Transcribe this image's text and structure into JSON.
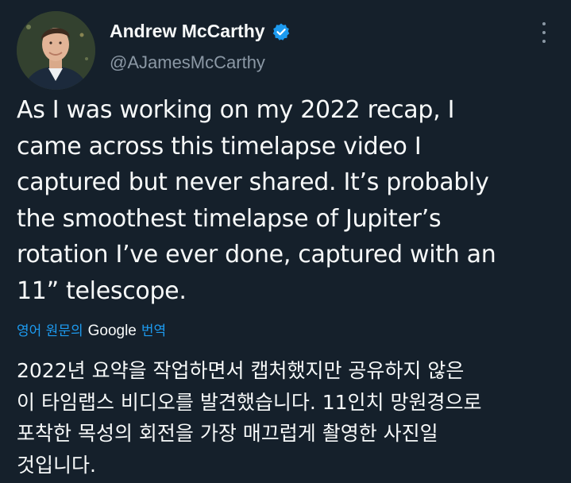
{
  "author": {
    "name": "Andrew McCarthy",
    "handle": "@AJamesMcCarthy",
    "verified": true,
    "avatar_icon": "profile-photo"
  },
  "tweet": {
    "text": "As I was working on my 2022 recap, I\ncame across this timelapse video I\ncaptured but never shared. It’s probably\nthe smoothest timelapse of Jupiter’s\nrotation I’ve ever done, captured with an\n11” telescope."
  },
  "translation": {
    "prefix": "영어 원문의",
    "provider": "Google",
    "suffix": "번역",
    "text": "2022년 요약을 작업하면서 캡처했지만 공유하지 않은\n이 타임랩스 비디오를 발견했습니다. 11인치 망원경으로\n포착한 목성의 회전을 가장 매끄럽게 촬영한 사진일\n것입니다."
  },
  "colors": {
    "background": "#15202b",
    "text": "#f7f9f9",
    "muted": "#8b98a5",
    "accent": "#1d9bf0"
  }
}
